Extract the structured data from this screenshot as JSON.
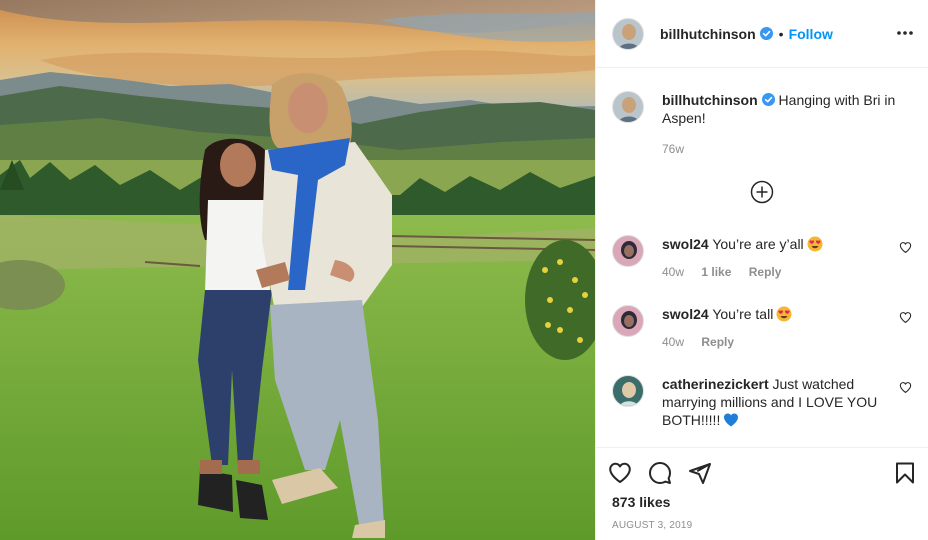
{
  "post": {
    "photo_alt": "Hanging with Bri in Aspen!",
    "author": {
      "username": "billhutchinson",
      "verified": true
    },
    "header": {
      "dot": "•",
      "follow_label": "Follow",
      "more_icon": "more-horizontal-icon"
    },
    "caption": {
      "username": "billhutchinson",
      "text": "Hanging with Bri in Aspen!",
      "time": "76w"
    },
    "load_more_icon": "plus-circle-icon",
    "comments": [
      {
        "username": "swol24",
        "text": "You’re are y’all",
        "emoji": "heart-eyes-emoji",
        "time": "40w",
        "likes": "1 like",
        "reply": "Reply"
      },
      {
        "username": "swol24",
        "text": "You’re tall",
        "emoji": "heart-eyes-emoji",
        "time": "40w",
        "likes": "",
        "reply": "Reply"
      },
      {
        "username": "catherinezickert",
        "text": "Just watched marrying millions and I LOVE YOU BOTH!!!!!",
        "emoji": "blue-heart-emoji",
        "time": "",
        "likes": "",
        "reply": ""
      }
    ],
    "footer": {
      "likes": "873 likes",
      "date": "AUGUST 3, 2019",
      "icons": [
        "heart-icon",
        "comment-icon",
        "share-icon",
        "bookmark-icon"
      ]
    },
    "colors": {
      "follow": "#0095f6",
      "verified": "#3897f0",
      "meta": "#8e8e8e",
      "border": "#efefef"
    }
  }
}
